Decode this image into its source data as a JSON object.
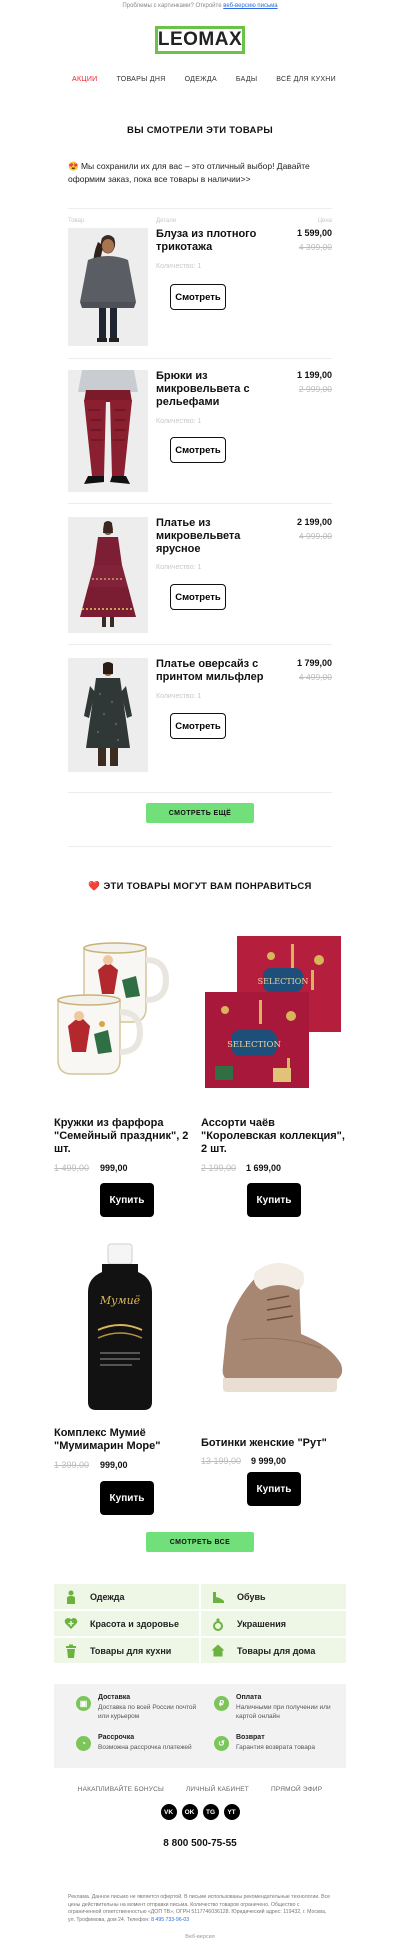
{
  "preheader": {
    "text": "Проблемы с картинками? Откройте",
    "link": "веб-версию письма"
  },
  "logo": "LEOMAX",
  "nav": [
    "АКЦИИ",
    "ТОВАРЫ ДНЯ",
    "ОДЕЖДА",
    "БАДЫ",
    "ВСЁ ДЛЯ КУХНИ"
  ],
  "viewed": {
    "title": "ВЫ СМОТРЕЛИ ЭТИ ТОВАРЫ",
    "intro_emoji": "😍",
    "intro": "Мы сохранили их для вас – это отличный выбор! Давайте оформим заказ, пока все товары в наличии>>",
    "columns": [
      "Товар",
      "Детали",
      "Цена"
    ],
    "products": [
      {
        "name": "Блуза из плотного трикотажа",
        "price": "1 599,00",
        "old": "4 399,00",
        "qty": "Количество: 1",
        "btn": "Смотреть"
      },
      {
        "name": "Брюки из микровельвета с рельефами",
        "price": "1 199,00",
        "old": "2 999,00",
        "qty": "Количество: 1",
        "btn": "Смотреть"
      },
      {
        "name": "Платье из микровельвета ярусное",
        "price": "2 199,00",
        "old": "4 999,00",
        "qty": "Количество: 1",
        "btn": "Смотреть"
      },
      {
        "name": "Платье оверсайз с принтом мильфлер",
        "price": "1 799,00",
        "old": "4 499,00",
        "qty": "Количество: 1",
        "btn": "Смотреть"
      }
    ],
    "more_btn": "СМОТРЕТЬ ЕЩЁ"
  },
  "recommend": {
    "title": "ЭТИ ТОВАРЫ МОГУТ ВАМ ПОНРАВИТЬСЯ",
    "title_emoji": "❤️",
    "items": [
      {
        "name": "Кружки из фарфора \"Семейный праздник\", 2 шт.",
        "old": "1 499,00",
        "price": "999,00",
        "btn": "Купить"
      },
      {
        "name": "Ассорти чаёв \"Королевская коллекция\", 2 шт.",
        "old": "2 199,00",
        "price": "1 699,00",
        "btn": "Купить"
      },
      {
        "name": "Комплекс Мумиё \"Мумимарин Море\"",
        "old": "1 399,00",
        "price": "999,00",
        "btn": "Купить"
      },
      {
        "name": "Ботинки женские \"Рут\"",
        "old": "13 199,00",
        "price": "9 999,00",
        "btn": "Купить"
      }
    ],
    "all_btn": "СМОТРЕТЬ ВСЕ"
  },
  "categories": [
    "Одежда",
    "Обувь",
    "Красота и здоровье",
    "Украшения",
    "Товары для кухни",
    "Товары для дома"
  ],
  "benefits": [
    {
      "title": "Доставка",
      "text": "Доставка по всей России почтой или курьером"
    },
    {
      "title": "Оплата",
      "text": "Наличными при получении или картой онлайн"
    },
    {
      "title": "Рассрочка",
      "text": "Возможна рассрочка платежей"
    },
    {
      "title": "Возврат",
      "text": "Гарантия возврата товара"
    }
  ],
  "footer_links": [
    "НАКАПЛИВАЙТЕ БОНУСЫ",
    "ЛИЧНЫЙ КАБИНЕТ",
    "ПРЯМОЙ ЭФИР"
  ],
  "socials": [
    "VK",
    "OK",
    "TG",
    "YT"
  ],
  "phone": "8 800 500-75-55",
  "legal": "Реклама. Данное письмо не является офертой. В письме использованы рекомендательные технологии. Все цены действительны на момент отправки письма. Количество товаров ограничено. Общество с ограниченной ответственностью «ДОП ТВ», ОГРН 5117746036128. Юридический адрес: 119432, г. Москва, ул. Трофимова, дом 24. Телефон:",
  "legal_phone": "8 495 733-96-03",
  "web_version": "Веб-версия"
}
